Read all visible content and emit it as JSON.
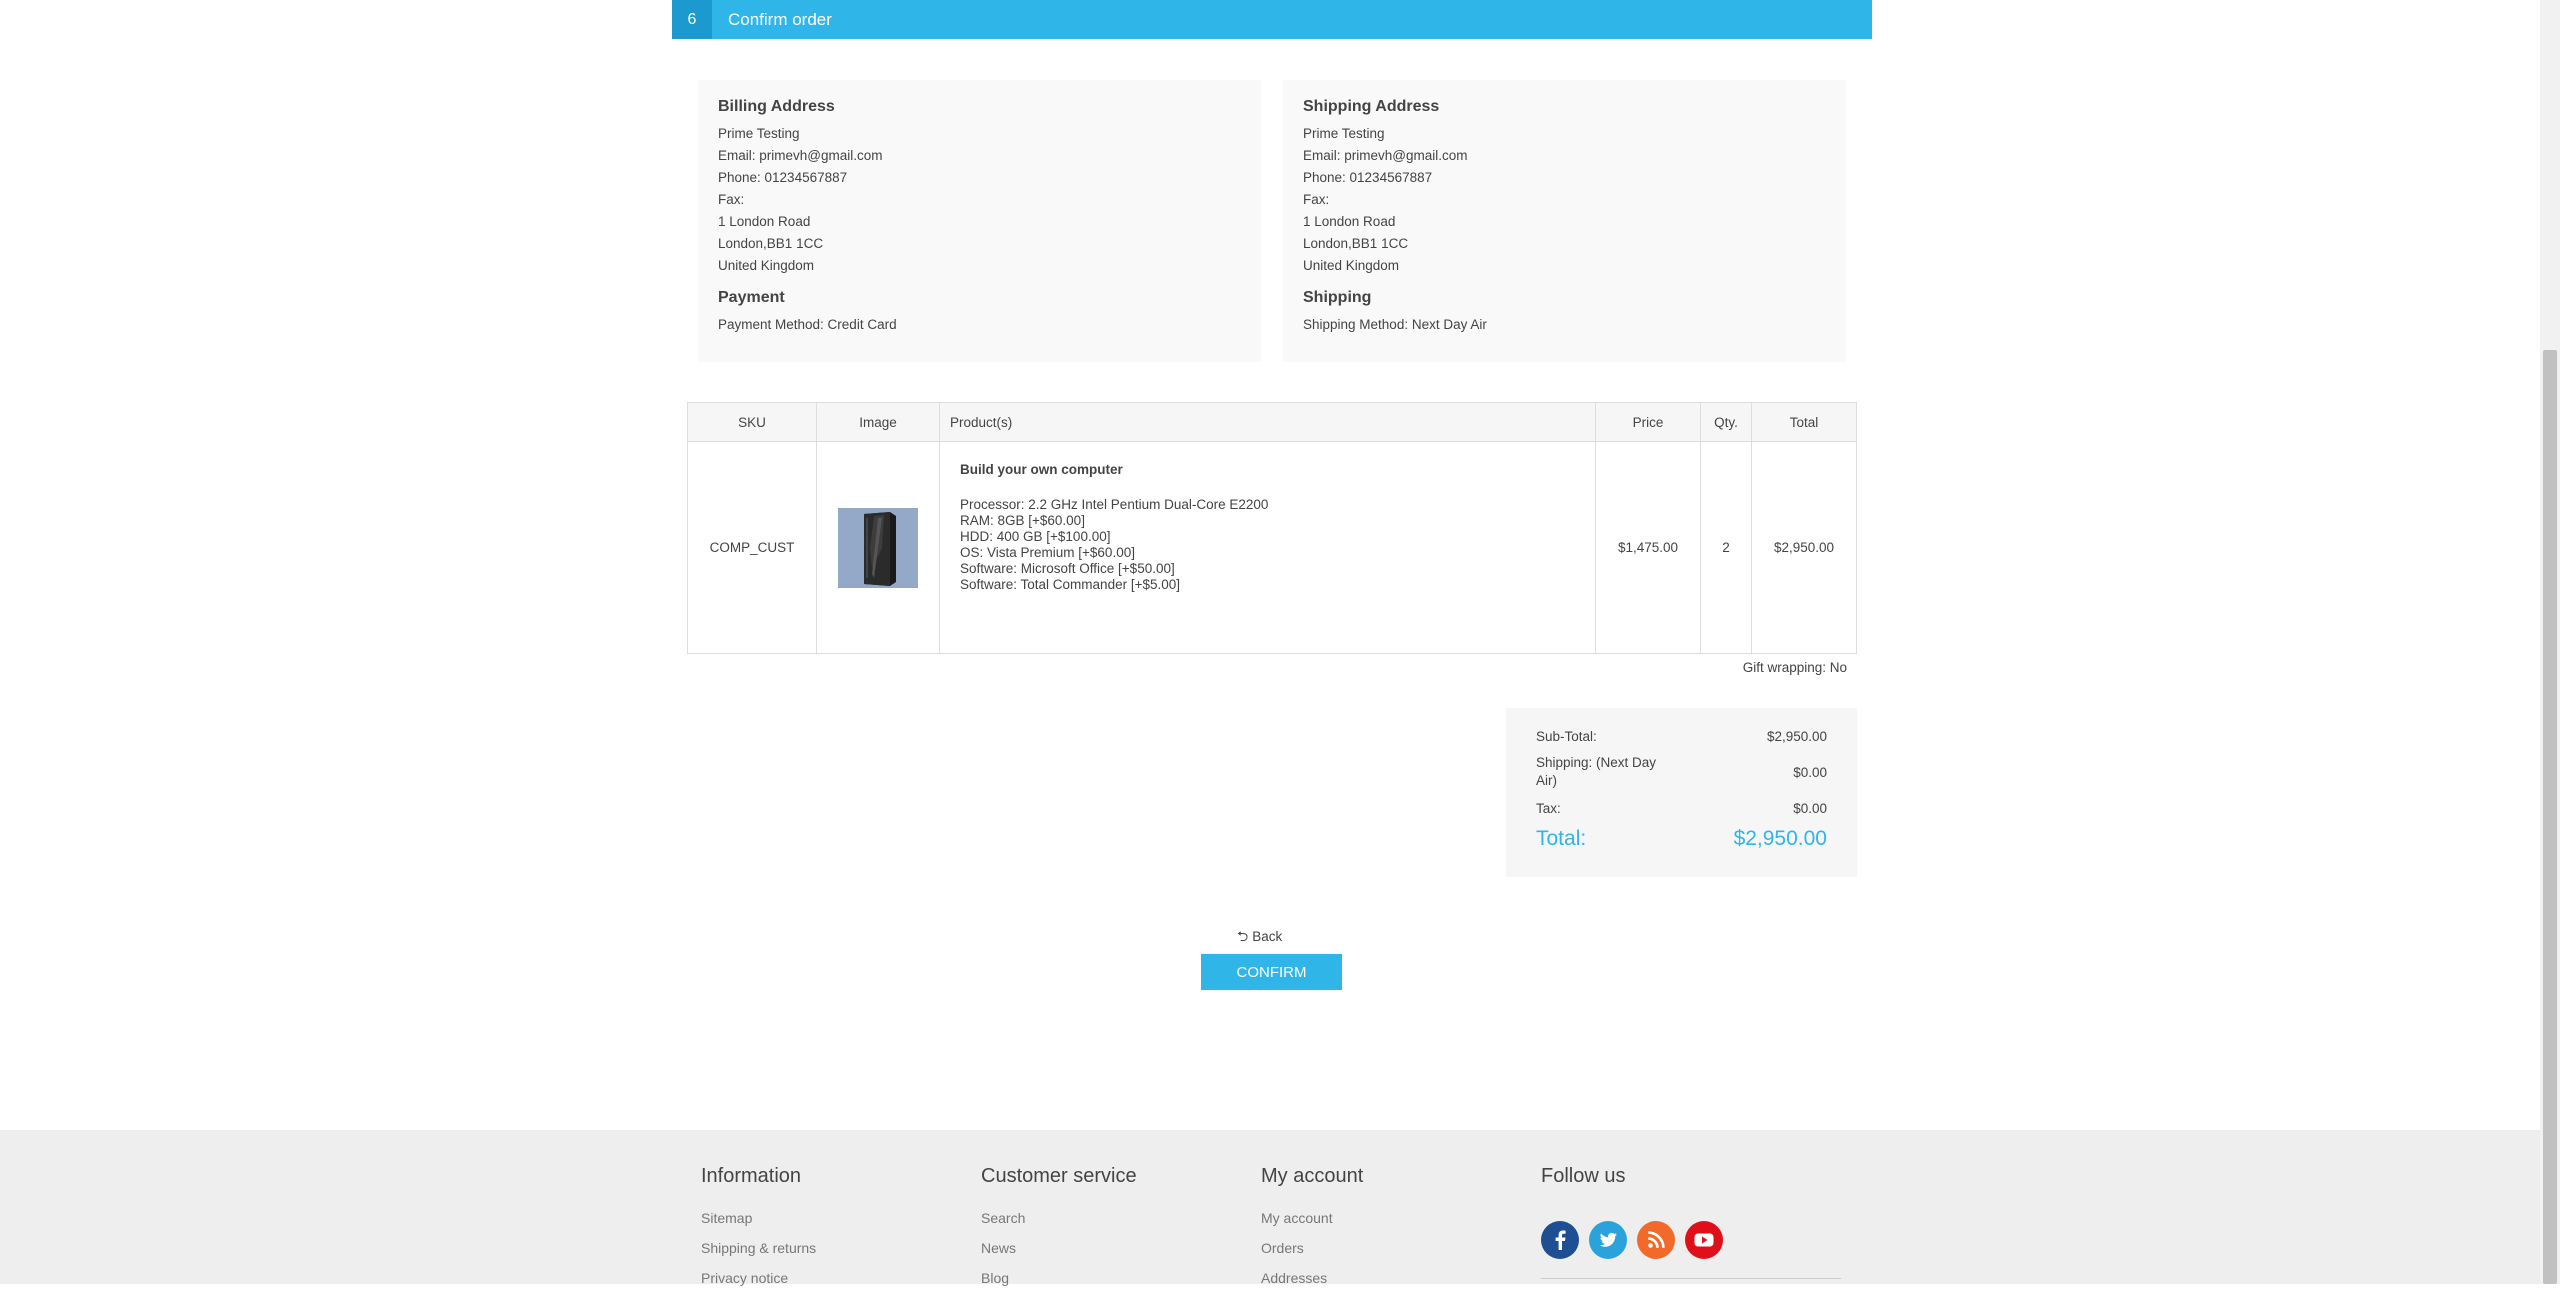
{
  "step": {
    "number": "6",
    "title": "Confirm order"
  },
  "billing": {
    "title": "Billing Address",
    "name": "Prime Testing",
    "email": "Email: primevh@gmail.com",
    "phone": "Phone: 01234567887",
    "fax": "Fax:",
    "address1": "1 London Road",
    "city": "London,BB1 1CC",
    "country": "United Kingdom"
  },
  "payment": {
    "title": "Payment",
    "method": "Payment Method: Credit Card"
  },
  "shipping_address": {
    "title": "Shipping Address",
    "name": "Prime Testing",
    "email": "Email: primevh@gmail.com",
    "phone": "Phone: 01234567887",
    "fax": "Fax:",
    "address1": "1 London Road",
    "city": "London,BB1 1CC",
    "country": "United Kingdom"
  },
  "shipping": {
    "title": "Shipping",
    "method": "Shipping Method: Next Day Air"
  },
  "table": {
    "headers": {
      "sku": "SKU",
      "image": "Image",
      "product": "Product(s)",
      "price": "Price",
      "qty": "Qty.",
      "total": "Total"
    },
    "rows": [
      {
        "sku": "COMP_CUST",
        "image_icon": "computer-tower-icon",
        "name": "Build your own computer",
        "attributes": [
          "Processor: 2.2 GHz Intel Pentium Dual-Core E2200",
          "RAM: 8GB [+$60.00]",
          "HDD: 400 GB [+$100.00]",
          "OS: Vista Premium [+$60.00]",
          "Software: Microsoft Office [+$50.00]",
          "Software: Total Commander [+$5.00]"
        ],
        "price": "$1,475.00",
        "qty": "2",
        "total": "$2,950.00"
      }
    ]
  },
  "gift_wrapping": "Gift wrapping: No",
  "totals": {
    "subtotal_label": "Sub-Total:",
    "subtotal": "$2,950.00",
    "shipping_label": "Shipping: (Next Day Air)",
    "shipping": "$0.00",
    "tax_label": "Tax:",
    "tax": "$0.00",
    "total_label": "Total:",
    "total": "$2,950.00"
  },
  "actions": {
    "back": "Back",
    "confirm": "Confirm"
  },
  "footer": {
    "information": {
      "title": "Information",
      "links": [
        "Sitemap",
        "Shipping & returns",
        "Privacy notice"
      ]
    },
    "customer_service": {
      "title": "Customer service",
      "links": [
        "Search",
        "News",
        "Blog"
      ]
    },
    "my_account": {
      "title": "My account",
      "links": [
        "My account",
        "Orders",
        "Addresses"
      ]
    },
    "follow_us": {
      "title": "Follow us",
      "icons": [
        "facebook-icon",
        "twitter-icon",
        "rss-icon",
        "youtube-icon"
      ]
    }
  },
  "colors": {
    "accent": "#2fb5e8",
    "accent_dark": "#1c9ad0",
    "facebook": "#1d4f92",
    "twitter": "#2aa3dc",
    "rss": "#f26a2a",
    "youtube": "#e0101b"
  }
}
